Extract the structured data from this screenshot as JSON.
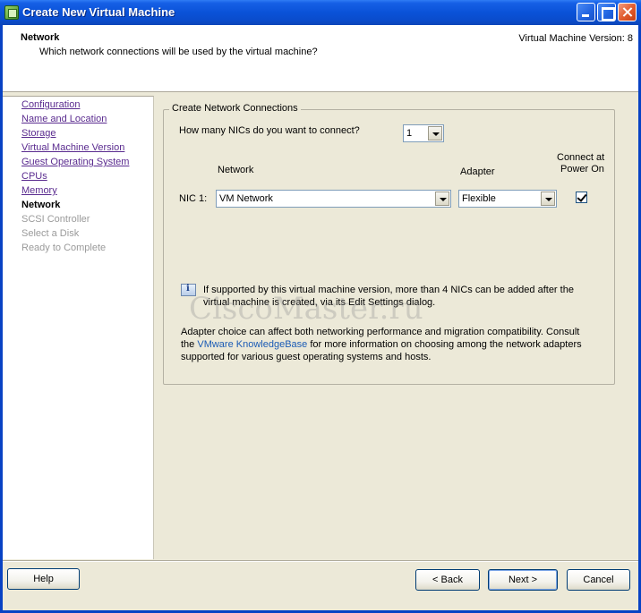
{
  "window": {
    "title": "Create New Virtual Machine"
  },
  "header": {
    "title": "Network",
    "subtitle": "Which network connections will be used by the virtual machine?",
    "version": "Virtual Machine Version: 8"
  },
  "nav": {
    "items": [
      {
        "label": "Configuration",
        "state": "link"
      },
      {
        "label": "Name and Location",
        "state": "link"
      },
      {
        "label": "Storage",
        "state": "link"
      },
      {
        "label": "Virtual Machine Version",
        "state": "link"
      },
      {
        "label": "Guest Operating System",
        "state": "link"
      },
      {
        "label": "CPUs",
        "state": "link"
      },
      {
        "label": "Memory",
        "state": "link"
      },
      {
        "label": "Network",
        "state": "current"
      },
      {
        "label": "SCSI Controller",
        "state": "disabled"
      },
      {
        "label": "Select a Disk",
        "state": "disabled"
      },
      {
        "label": "Ready to Complete",
        "state": "disabled"
      }
    ]
  },
  "main": {
    "group_label": "Create Network Connections",
    "nic_count_question": "How many NICs do you want to connect?",
    "nic_count_value": "1",
    "col_network": "Network",
    "col_adapter": "Adapter",
    "col_connect_line1": "Connect at",
    "col_connect_line2": "Power On",
    "nic_row": {
      "label": "NIC 1:",
      "network": "VM Network",
      "adapter": "Flexible",
      "connect_at_power_on": true
    },
    "info_line1": "If supported by this virtual machine version, more than 4 NICs can be added after the",
    "info_line2": "virtual machine is created, via its Edit Settings dialog.",
    "watermark": "CiscoMaster.ru",
    "adapter_line1": "Adapter choice can affect both networking performance and migration compatibility. Consult",
    "adapter_line2_pre": "the ",
    "adapter_link": "VMware KnowledgeBase",
    "adapter_line2_post": " for more information on choosing among the network adapters",
    "adapter_line3": "supported for various guest operating systems and hosts."
  },
  "footer": {
    "help": "Help",
    "back": "< Back",
    "next": "Next >",
    "cancel": "Cancel"
  }
}
